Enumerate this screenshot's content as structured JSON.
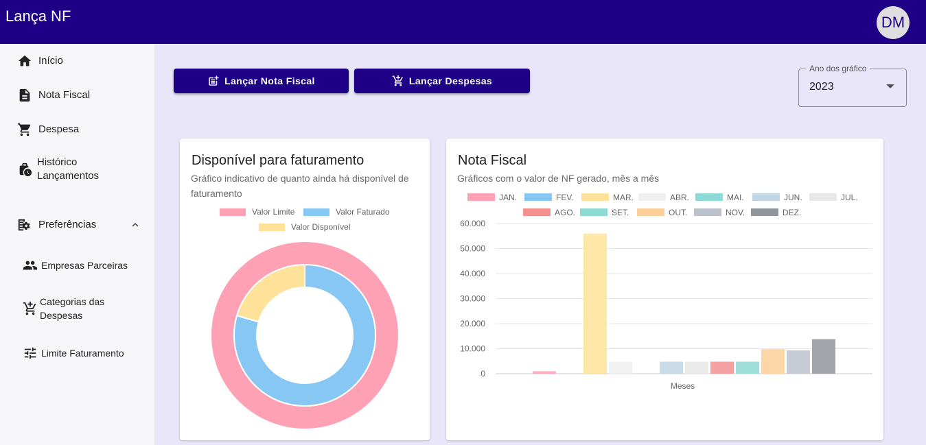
{
  "app": {
    "title": "Lança NF",
    "avatar_initials": "DM",
    "brand_color": "#1d0085"
  },
  "sidebar": {
    "items": [
      {
        "label": "Início",
        "icon": "home-icon"
      },
      {
        "label": "Nota Fiscal",
        "icon": "document-icon"
      },
      {
        "label": "Despesa",
        "icon": "cart-icon"
      },
      {
        "label": "Histórico\nLançamentos",
        "icon": "history-briefcase-icon"
      },
      {
        "label": "Preferências",
        "icon": "preferences-icon"
      }
    ],
    "subitems": [
      {
        "label": "Empresas Parceiras",
        "icon": "people-icon"
      },
      {
        "label": "Categorias das\nDespesas",
        "icon": "cart-add-icon"
      },
      {
        "label": "Limite Faturamento",
        "icon": "sliders-icon"
      }
    ]
  },
  "toolbar": {
    "nota_label": "Lançar Nota Fiscal",
    "despesa_label": "Lançar Despesas",
    "year_select": {
      "label": "Ano dos gráfico",
      "value": "2023"
    }
  },
  "donut_card": {
    "title": "Disponível para faturamento",
    "subtitle": "Gráfico indicativo de quanto ainda há disponível de faturamento",
    "legend": [
      {
        "name": "Valor Limite",
        "color": "#ffa1b5"
      },
      {
        "name": "Valor Faturado",
        "color": "#86c7f3"
      },
      {
        "name": "Valor Disponível",
        "color": "#ffe29a"
      }
    ]
  },
  "bar_card": {
    "title": "Nota Fiscal",
    "subtitle": "Gráficos com o valor de NF gerado, mês a mês"
  },
  "chart_data": [
    {
      "type": "pie",
      "title": "Disponível para faturamento",
      "rings": [
        {
          "slices": [
            {
              "name": "Valor Limite",
              "value": 100
            }
          ]
        },
        {
          "slices": [
            {
              "name": "Valor Faturado",
              "value": 79.5
            },
            {
              "name": "Valor Disponível",
              "value": 20.5
            }
          ]
        }
      ],
      "colors": [
        "#ffa1b5",
        "#86c7f3",
        "#ffe29a"
      ],
      "legend_position": "top"
    },
    {
      "type": "bar",
      "title": "Nota Fiscal",
      "xlabel": "Meses",
      "ylabel": "",
      "ylim": [
        0,
        60000
      ],
      "yticks": [
        "0",
        "10.000",
        "20.000",
        "30.000",
        "40.000",
        "50.000",
        "60.000"
      ],
      "grid": true,
      "legend_position": "top",
      "categories": [
        "Meses"
      ],
      "series": [
        {
          "name": "JAN.",
          "value": 1000,
          "color": "#ffa1b5"
        },
        {
          "name": "FEV.",
          "value": 0,
          "color": "#86c7f3"
        },
        {
          "name": "MAR.",
          "value": 56000,
          "color": "#ffe29a"
        },
        {
          "name": "ABR.",
          "value": 4800,
          "color": "#f0f0f0"
        },
        {
          "name": "MAI.",
          "value": 0,
          "color": "#8ed8d8"
        },
        {
          "name": "JUN.",
          "value": 4800,
          "color": "#c1d6e3"
        },
        {
          "name": "JUL.",
          "value": 4800,
          "color": "#e8e8e8"
        },
        {
          "name": "AGO.",
          "value": 4800,
          "color": "#f59090"
        },
        {
          "name": "SET.",
          "value": 4800,
          "color": "#8fd9d3"
        },
        {
          "name": "OUT.",
          "value": 9800,
          "color": "#fdcf98"
        },
        {
          "name": "NOV.",
          "value": 9300,
          "color": "#bcc2cc"
        },
        {
          "name": "DEZ.",
          "value": 13800,
          "color": "#91959c"
        }
      ]
    }
  ]
}
